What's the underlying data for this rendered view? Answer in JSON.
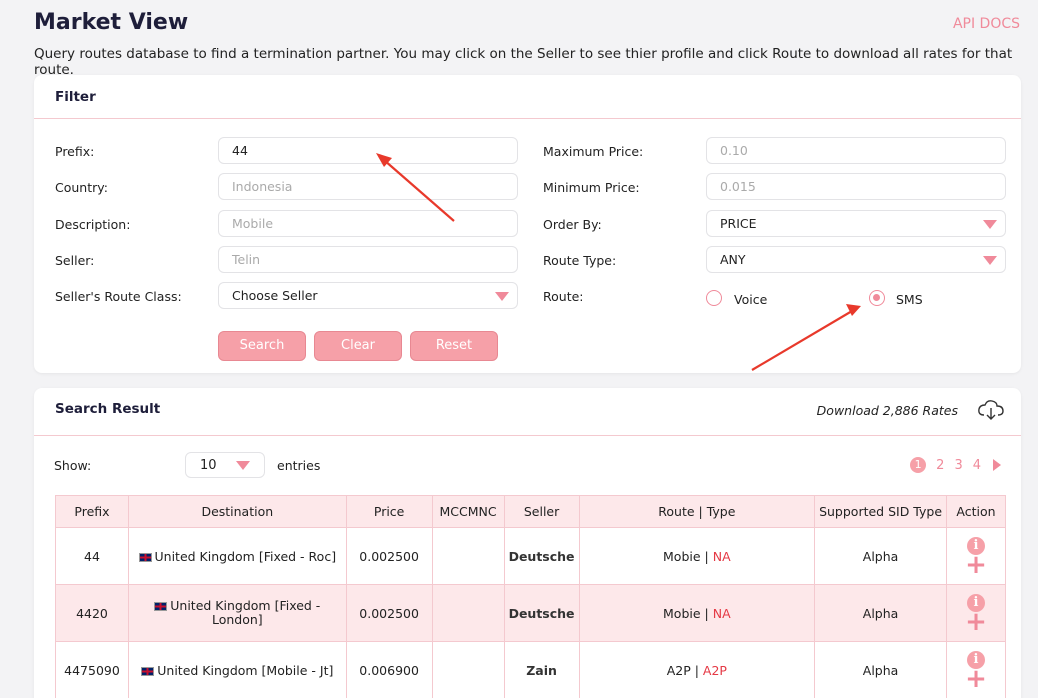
{
  "header": {
    "title": "Market View",
    "api_docs": "API DOCS",
    "subtitle": "Query routes database to find a termination partner. You may click on the Seller to see thier profile and click Route to download all rates for that route."
  },
  "filter": {
    "title": "Filter",
    "prefix": {
      "label": "Prefix:",
      "value": "44"
    },
    "country": {
      "label": "Country:",
      "placeholder": "Indonesia"
    },
    "description": {
      "label": "Description:",
      "placeholder": "Mobile"
    },
    "seller": {
      "label": "Seller:",
      "placeholder": "Telin"
    },
    "route_class": {
      "label": "Seller's Route Class:",
      "value": "Choose Seller"
    },
    "max_price": {
      "label": "Maximum Price:",
      "placeholder": "0.10"
    },
    "min_price": {
      "label": "Minimum Price:",
      "placeholder": "0.015"
    },
    "order_by": {
      "label": "Order By:",
      "value": "PRICE"
    },
    "route_type": {
      "label": "Route Type:",
      "value": "ANY"
    },
    "route": {
      "label": "Route:",
      "voice": "Voice",
      "sms": "SMS",
      "selected": "SMS"
    },
    "buttons": {
      "search": "Search",
      "clear": "Clear",
      "reset": "Reset"
    }
  },
  "results": {
    "title": "Search Result",
    "download": "Download 2,886 Rates",
    "show_label": "Show:",
    "entries_value": "10",
    "entries_label": "entries",
    "pages": [
      "1",
      "2",
      "3",
      "4"
    ],
    "columns": [
      "Prefix",
      "Destination",
      "Price",
      "MCCMNC",
      "Seller",
      "Route | Type",
      "Supported SID Type",
      "Action"
    ],
    "rows": [
      {
        "prefix": "44",
        "destination": "United Kingdom [Fixed - Roc]",
        "price": "0.002500",
        "mccmnc": "",
        "seller": "Deutsche",
        "route": "Mobie",
        "type": "NA",
        "sid": "Alpha"
      },
      {
        "prefix": "4420",
        "destination": "United Kingdom [Fixed - London]",
        "price": "0.002500",
        "mccmnc": "",
        "seller": "Deutsche",
        "route": "Mobie",
        "type": "NA",
        "sid": "Alpha"
      },
      {
        "prefix": "4475090",
        "destination": "United Kingdom [Mobile - Jt]",
        "price": "0.006900",
        "mccmnc": "",
        "seller": "Zain",
        "route": "A2P",
        "type": "A2P",
        "sid": "Alpha"
      }
    ]
  },
  "icons": {
    "info": "i",
    "plus": "+"
  },
  "colors": {
    "accent": "#f08a9a",
    "button": "#f6a0a8",
    "row_alt": "#fde8ea",
    "na": "#e53945"
  }
}
